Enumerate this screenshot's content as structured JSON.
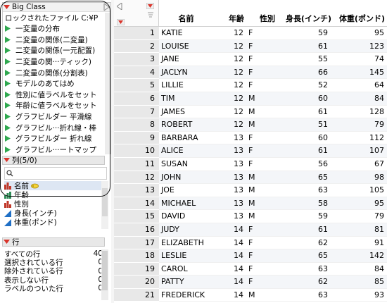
{
  "table_panel": {
    "title": "Big Class",
    "locked_file": "ロックされたファイル C:¥P",
    "scripts": [
      "一変量の分布",
      "二変量の関係(二変量)",
      "二変量の関係(一元配置)",
      "二変量の関···ティック)",
      "二変量の関係(分割表)",
      "モデルのあてはめ",
      "性別に値ラベルをセット",
      "年齢に値ラベルをセット",
      "グラフビルダー 平滑線",
      "グラフビル···折れ線・棒",
      "グラフビルダー 折れ線",
      "グラフビル···ートマップ"
    ]
  },
  "columns_panel": {
    "title": "列(5/0)",
    "search_placeholder": "",
    "items": [
      {
        "label": "名前",
        "icon": "nominal-icon",
        "extra": "key-icon"
      },
      {
        "label": "年齢",
        "icon": "ordinal-icon"
      },
      {
        "label": "性別",
        "icon": "nominal-icon"
      },
      {
        "label": "身長(インチ)",
        "icon": "continuous-icon"
      },
      {
        "label": "体重(ポンド)",
        "icon": "continuous-icon"
      }
    ]
  },
  "rows_panel": {
    "title": "行",
    "items": [
      {
        "label": "すべての行",
        "value": "40"
      },
      {
        "label": "選択されている行",
        "value": "0"
      },
      {
        "label": "除外されている行",
        "value": "0"
      },
      {
        "label": "表示しない行",
        "value": "0"
      },
      {
        "label": "ラベルのついた行",
        "value": "0"
      }
    ]
  },
  "grid": {
    "headers": {
      "name": "名前",
      "age": "年齢",
      "sex": "性別",
      "height": "身長(インチ)",
      "weight": "体重(ポンド)"
    },
    "rows": [
      {
        "n": "1",
        "name": "KATIE",
        "age": "12",
        "sex": "F",
        "height": "59",
        "weight": "95"
      },
      {
        "n": "2",
        "name": "LOUISE",
        "age": "12",
        "sex": "F",
        "height": "61",
        "weight": "123"
      },
      {
        "n": "3",
        "name": "JANE",
        "age": "12",
        "sex": "F",
        "height": "55",
        "weight": "74"
      },
      {
        "n": "4",
        "name": "JACLYN",
        "age": "12",
        "sex": "F",
        "height": "66",
        "weight": "145"
      },
      {
        "n": "5",
        "name": "LILLIE",
        "age": "12",
        "sex": "F",
        "height": "52",
        "weight": "64"
      },
      {
        "n": "6",
        "name": "TIM",
        "age": "12",
        "sex": "M",
        "height": "60",
        "weight": "84"
      },
      {
        "n": "7",
        "name": "JAMES",
        "age": "12",
        "sex": "M",
        "height": "61",
        "weight": "128"
      },
      {
        "n": "8",
        "name": "ROBERT",
        "age": "12",
        "sex": "M",
        "height": "51",
        "weight": "79"
      },
      {
        "n": "9",
        "name": "BARBARA",
        "age": "13",
        "sex": "F",
        "height": "60",
        "weight": "112"
      },
      {
        "n": "10",
        "name": "ALICE",
        "age": "13",
        "sex": "F",
        "height": "61",
        "weight": "107"
      },
      {
        "n": "11",
        "name": "SUSAN",
        "age": "13",
        "sex": "F",
        "height": "56",
        "weight": "67"
      },
      {
        "n": "12",
        "name": "JOHN",
        "age": "13",
        "sex": "M",
        "height": "65",
        "weight": "98"
      },
      {
        "n": "13",
        "name": "JOE",
        "age": "13",
        "sex": "M",
        "height": "63",
        "weight": "105"
      },
      {
        "n": "14",
        "name": "MICHAEL",
        "age": "13",
        "sex": "M",
        "height": "58",
        "weight": "95"
      },
      {
        "n": "15",
        "name": "DAVID",
        "age": "13",
        "sex": "M",
        "height": "59",
        "weight": "79"
      },
      {
        "n": "16",
        "name": "JUDY",
        "age": "14",
        "sex": "F",
        "height": "61",
        "weight": "81"
      },
      {
        "n": "17",
        "name": "ELIZABETH",
        "age": "14",
        "sex": "F",
        "height": "62",
        "weight": "91"
      },
      {
        "n": "18",
        "name": "LESLIE",
        "age": "14",
        "sex": "F",
        "height": "65",
        "weight": "142"
      },
      {
        "n": "19",
        "name": "CAROL",
        "age": "14",
        "sex": "F",
        "height": "63",
        "weight": "84"
      },
      {
        "n": "20",
        "name": "PATTY",
        "age": "14",
        "sex": "F",
        "height": "62",
        "weight": "85"
      },
      {
        "n": "21",
        "name": "FREDERICK",
        "age": "14",
        "sex": "M",
        "height": "63",
        "weight": "93"
      }
    ]
  },
  "colors": {
    "menu_red": "#d9342b",
    "play_green": "#2fa84f",
    "nominal_red": "#c0392b",
    "continuous_blue": "#1f6fc5"
  }
}
